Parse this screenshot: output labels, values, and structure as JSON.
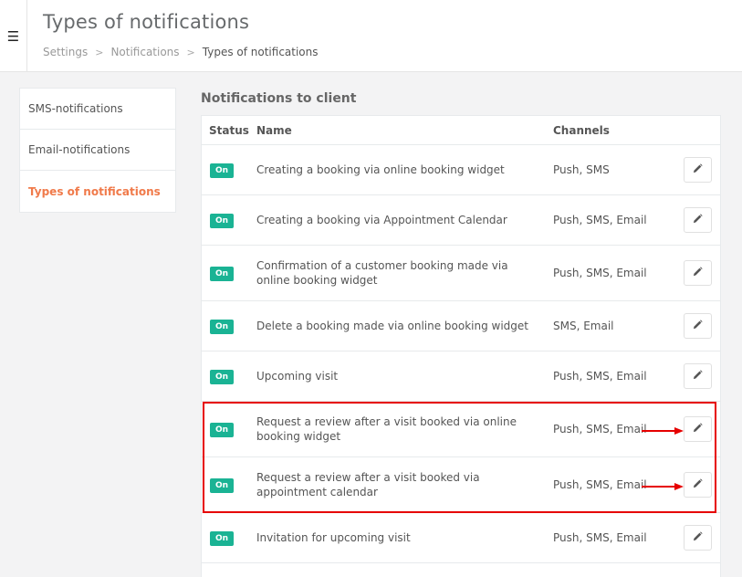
{
  "header": {
    "menu_icon": "hamburger-icon",
    "title": "Types of notifications",
    "breadcrumb": [
      "Settings",
      "Notifications",
      "Types of notifications"
    ],
    "separator": ">"
  },
  "sidebar": {
    "items": [
      {
        "label": "SMS-notifications"
      },
      {
        "label": "Email-notifications"
      },
      {
        "label": "Types of notifications",
        "active": true
      }
    ]
  },
  "section": {
    "title": "Notifications to client"
  },
  "table": {
    "columns": {
      "status": "Status",
      "name": "Name",
      "channels": "Channels"
    },
    "rows": [
      {
        "status": "On",
        "name": "Creating a booking via online booking widget",
        "channels": "Push, SMS"
      },
      {
        "status": "On",
        "name": "Creating a booking via Appointment Calendar",
        "channels": "Push, SMS, Email"
      },
      {
        "status": "On",
        "name": "Confirmation of a customer booking made via online booking widget",
        "channels": "Push, SMS, Email"
      },
      {
        "status": "On",
        "name": "Delete a booking made via online booking widget",
        "channels": "SMS, Email"
      },
      {
        "status": "On",
        "name": "Upcoming visit",
        "channels": "Push, SMS, Email"
      },
      {
        "status": "On",
        "name": "Request a review after a visit booked via online booking widget",
        "channels": "Push, SMS, Email"
      },
      {
        "status": "On",
        "name": "Request a review after a visit booked via appointment calendar",
        "channels": "Push, SMS, Email"
      },
      {
        "status": "On",
        "name": "Invitation for upcoming visit",
        "channels": "Push, SMS, Email"
      }
    ]
  },
  "colors": {
    "badge": "#1ab394",
    "active_nav": "#f07a4a",
    "annotation": "#e60000"
  },
  "icons": {
    "edit": "pencil-icon"
  }
}
